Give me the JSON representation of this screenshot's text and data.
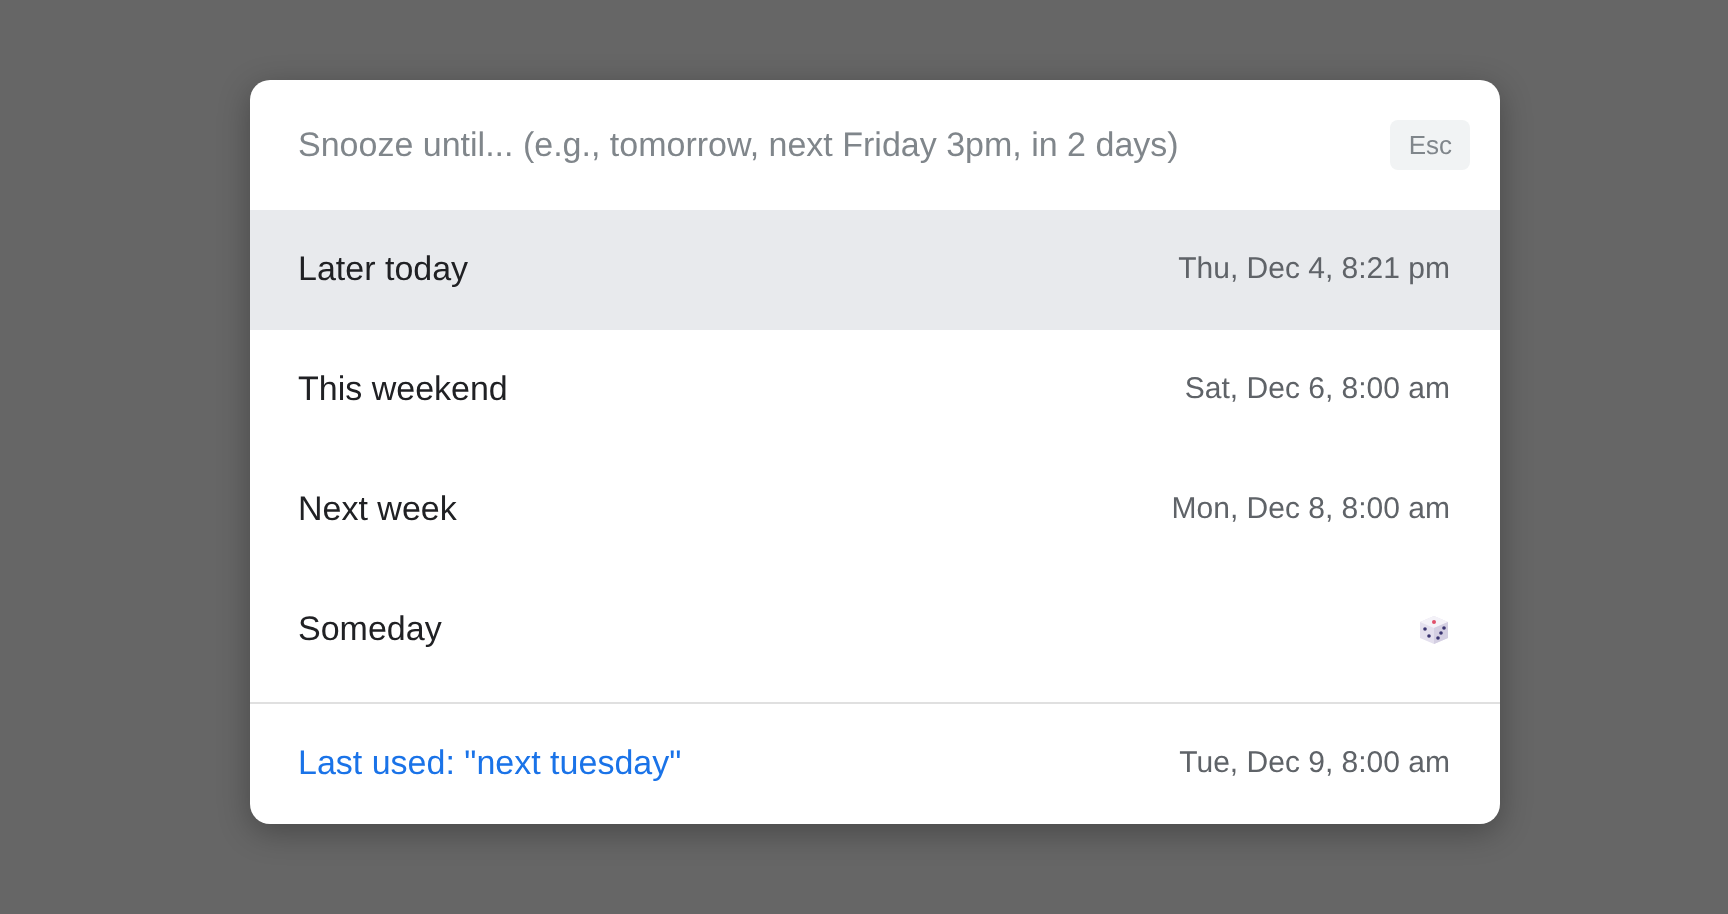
{
  "search": {
    "placeholder": "Snooze until... (e.g., tomorrow, next Friday 3pm, in 2 days)",
    "key_hint": "Esc"
  },
  "options": [
    {
      "label": "Later today",
      "kind": "time",
      "value": "Thu, Dec 4, 8:21 pm",
      "selected": true
    },
    {
      "label": "This weekend",
      "kind": "time",
      "value": "Sat, Dec 6, 8:00 am",
      "selected": false
    },
    {
      "label": "Next week",
      "kind": "time",
      "value": "Mon, Dec 8, 8:00 am",
      "selected": false
    },
    {
      "label": "Someday",
      "kind": "dice",
      "selected": false
    }
  ],
  "last_used": {
    "label": "Last used: \"next tuesday\"",
    "value": "Tue, Dec 9, 8:00 am",
    "selected": false
  }
}
